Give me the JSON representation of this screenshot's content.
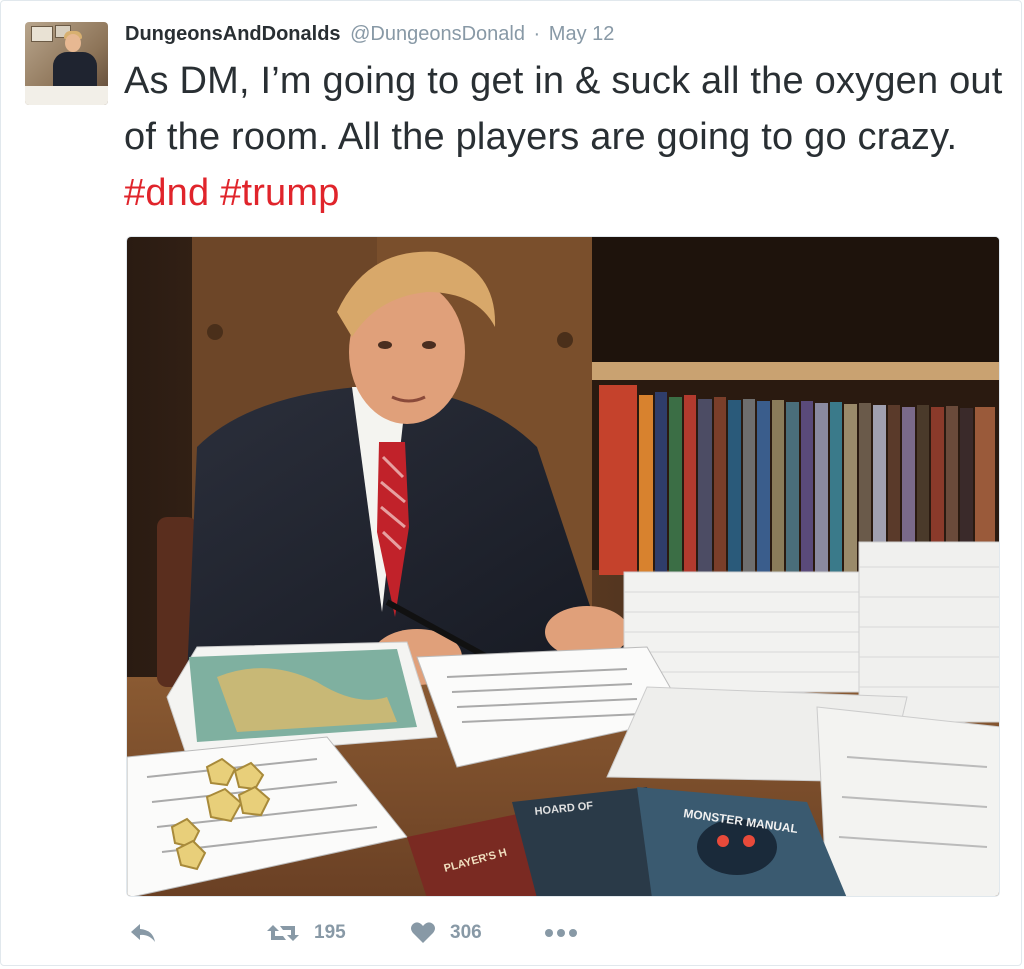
{
  "tweet": {
    "display_name": "DungeonsAndDonalds",
    "handle": "@DungeonsDonald",
    "separator": "·",
    "date": "May 12",
    "text_before_tags": "As DM, I’m going to get in & suck all the oxygen out of the room. All the players are going to go crazy. ",
    "hashtags": [
      "#dnd",
      "#trump"
    ],
    "retweet_count": "195",
    "like_count": "306"
  },
  "media": {
    "book_labels": [
      "MONSTER MANUAL",
      "PLAYER'S H",
      "HOARD OF"
    ]
  },
  "colors": {
    "text": "#292f33",
    "muted": "#8899a6",
    "hashtag": "#e0242b",
    "border": "#e1e8ed"
  },
  "icons": [
    "reply-icon",
    "retweet-icon",
    "heart-icon",
    "more-icon"
  ]
}
